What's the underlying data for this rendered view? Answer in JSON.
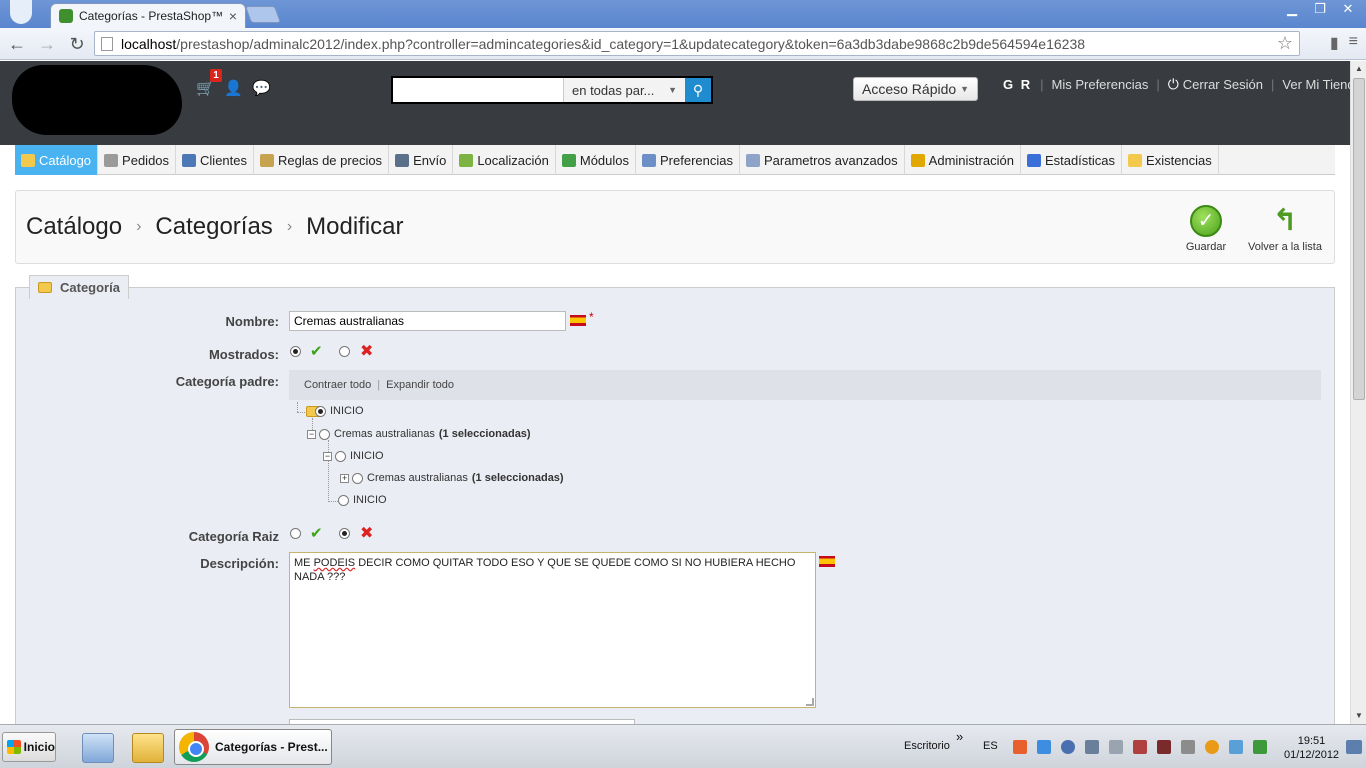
{
  "browser": {
    "tab_title": "Categorías - PrestaShop™",
    "tab_close": "×",
    "window_buttons": [
      "▁",
      "❐",
      "✕"
    ],
    "url_host": "localhost",
    "url_rest": "/prestashop/adminalc2012/index.php?controller=admincategories&id_category=1&updatecategory&token=6a3db3dabe9868c2b9de564594e16238",
    "bookmark_star": "☆"
  },
  "header": {
    "cart_badge": "1",
    "search": {
      "value": "",
      "scope": "en todas par..."
    },
    "quick_access": "Acceso Rápido",
    "user_initials": "G R",
    "links": {
      "preferences": "Mis Preferencias",
      "logout": "Cerrar Sesión",
      "view_shop": "Ver Mi Tienda"
    }
  },
  "menu": [
    {
      "label": "Catálogo",
      "color": "#f2c94c",
      "active": true
    },
    {
      "label": "Pedidos",
      "color": "#9a9a9a",
      "active": false
    },
    {
      "label": "Clientes",
      "color": "#4c78b8",
      "active": false
    },
    {
      "label": "Reglas de precios",
      "color": "#c8a34f",
      "active": false
    },
    {
      "label": "Envío",
      "color": "#5a6f8a",
      "active": false
    },
    {
      "label": "Localización",
      "color": "#7cb342",
      "active": false
    },
    {
      "label": "Módulos",
      "color": "#43a047",
      "active": false
    },
    {
      "label": "Preferencias",
      "color": "#6d8fc7",
      "active": false
    },
    {
      "label": "Parametros avanzados",
      "color": "#8ea3c8",
      "active": false
    },
    {
      "label": "Administración",
      "color": "#e0a800",
      "active": false
    },
    {
      "label": "Estadísticas",
      "color": "#3a6fd8",
      "active": false
    },
    {
      "label": "Existencias",
      "color": "#f2c94c",
      "active": false
    }
  ],
  "breadcrumb": [
    "Catálogo",
    "Categorías",
    "Modificar"
  ],
  "actions": {
    "save": "Guardar",
    "back": "Volver a la lista"
  },
  "form": {
    "legend": "Categoría",
    "name_label": "Nombre:",
    "name_value": "Cremas australianas",
    "required_mark": "*",
    "displayed_label": "Mostrados:",
    "displayed": true,
    "parent_label": "Categoría padre:",
    "tree_collapse": "Contraer todo",
    "tree_expand": "Expandir todo",
    "tree_separator": "|",
    "tree": {
      "root": "INICIO",
      "child_name": "Cremas australianas",
      "child_selected": "(1 seleccionadas)",
      "sub_inicio": "INICIO",
      "sub_child_name": "Cremas australianas",
      "sub_child_selected": "(1 seleccionadas)",
      "last_inicio": "INICIO"
    },
    "root_label": "Categoría Raiz",
    "is_root": false,
    "description_label": "Descripción:",
    "description_word_misspelled": "PODEIS",
    "description_before": "ME ",
    "description_after": " DECIR COMO QUITAR TODO ESO Y QUE SE QUEDE COMO SI NO HUBIERA HECHO NADA  ???"
  },
  "taskbar": {
    "start": "Inicio",
    "active_task": "Categorías - Prest...",
    "desktop": "Escritorio",
    "chevron": "»",
    "lang": "ES",
    "time": "19:51",
    "date": "01/12/2012"
  }
}
